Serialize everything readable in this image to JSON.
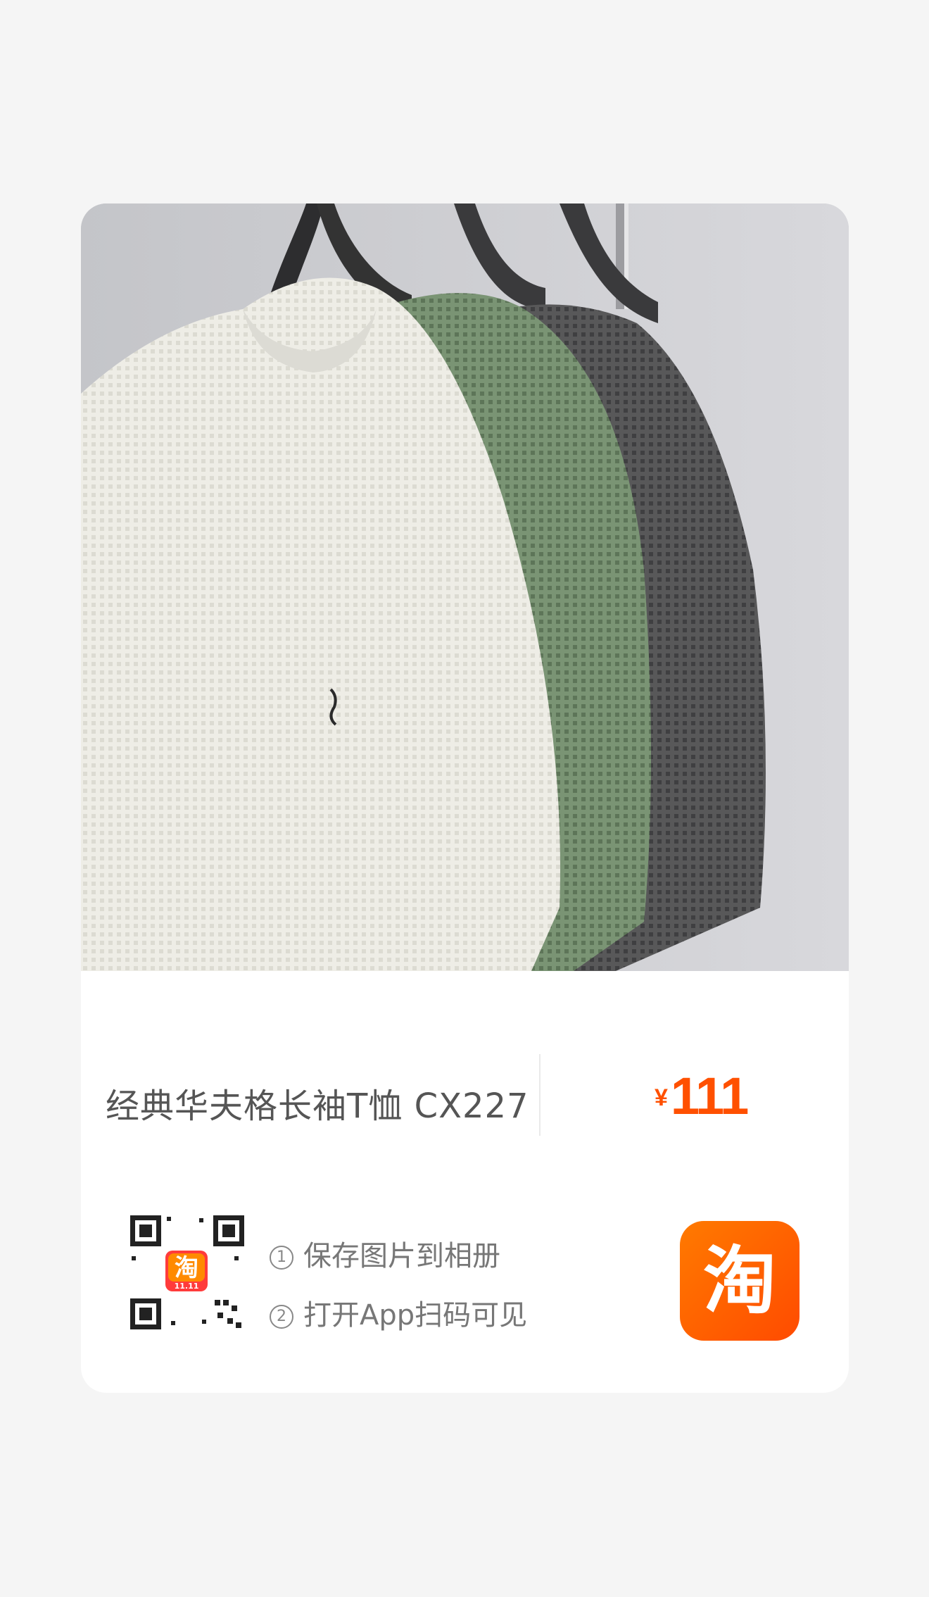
{
  "product": {
    "title": "经典华夫格长袖T恤 CX227",
    "currency": "¥",
    "price": "111"
  },
  "instructions": {
    "step1_num": "1",
    "step1_text": "保存图片到相册",
    "step2_num": "2",
    "step2_text": "打开App扫码可见"
  },
  "qr_badge": {
    "char": "淘",
    "sub": "11.11"
  },
  "app_logo": {
    "char": "淘"
  },
  "colors": {
    "accent": "#ff5000",
    "shirt_cream": "#ecebe4",
    "shirt_green": "#6f8a6a",
    "shirt_charcoal": "#4e4e50"
  },
  "icons": [
    "product-photo",
    "qr-code-icon",
    "taobao-app-icon"
  ]
}
